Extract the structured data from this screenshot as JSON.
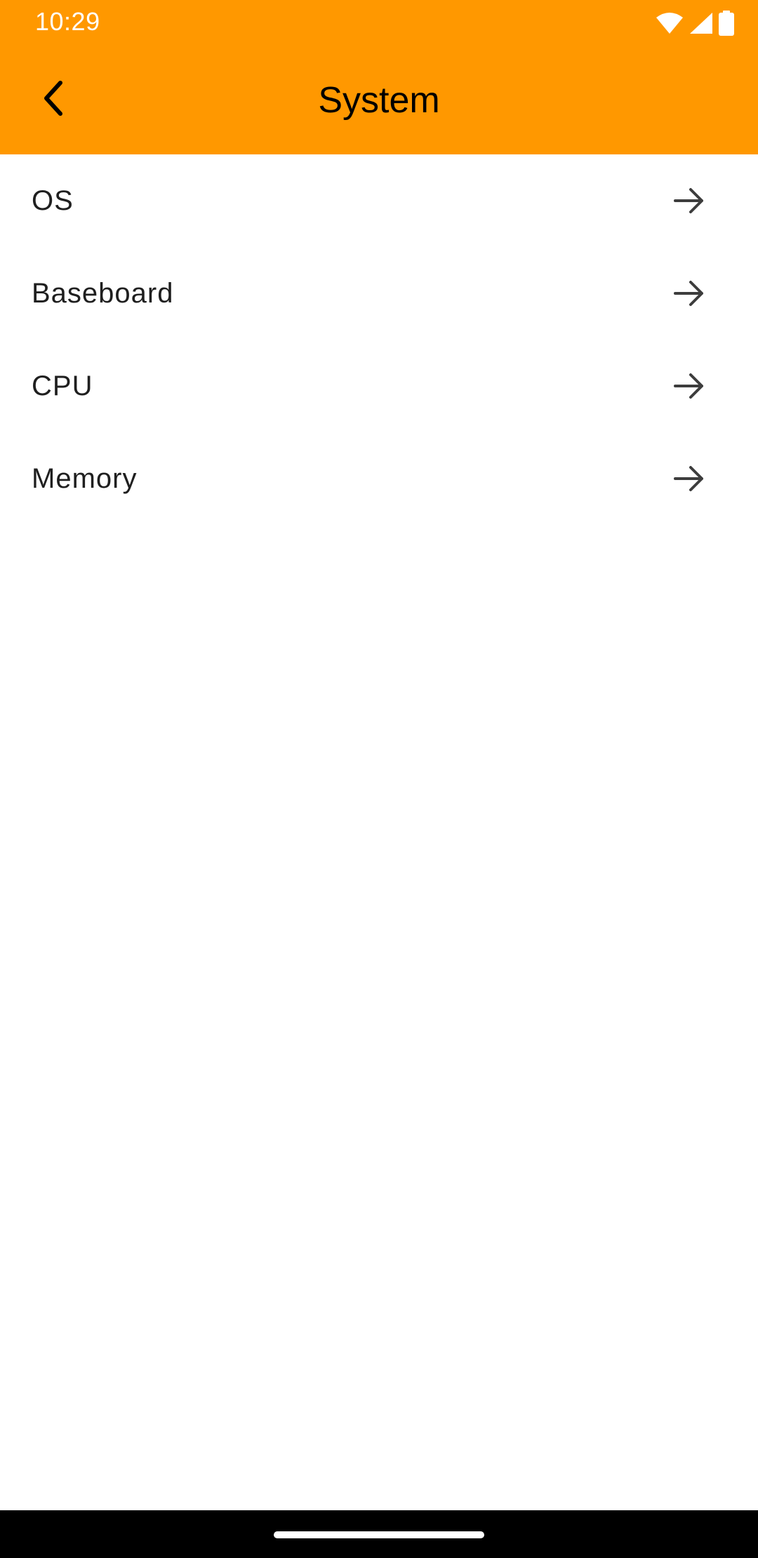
{
  "status_bar": {
    "time": "10:29",
    "icons": [
      "wifi-icon",
      "signal-icon",
      "battery-icon"
    ]
  },
  "app_bar": {
    "title": "System",
    "back_icon": "chevron-left-icon",
    "background_color": "#FF9800"
  },
  "list": {
    "items": [
      {
        "label": "OS",
        "icon": "arrow-right-icon"
      },
      {
        "label": "Baseboard",
        "icon": "arrow-right-icon"
      },
      {
        "label": "CPU",
        "icon": "arrow-right-icon"
      },
      {
        "label": "Memory",
        "icon": "arrow-right-icon"
      }
    ]
  },
  "nav_bar": {
    "handle": "gesture-handle"
  }
}
